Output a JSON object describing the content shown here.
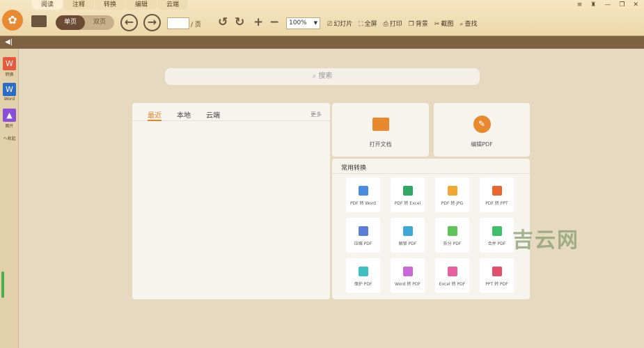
{
  "menu_tabs": [
    "阅读",
    "注释",
    "转换",
    "编辑",
    "云端"
  ],
  "toolbar": {
    "single_page": "单页",
    "double_page": "双页",
    "page_value": "",
    "page_suffix": "/ 页",
    "zoom": "100%",
    "tools": [
      {
        "icon": "slideshow-icon",
        "glyph": "⎚",
        "label": "幻灯片"
      },
      {
        "icon": "fullscreen-icon",
        "glyph": "⛶",
        "label": "全屏"
      },
      {
        "icon": "print-icon",
        "glyph": "⎙",
        "label": "打印"
      },
      {
        "icon": "background-icon",
        "glyph": "❐",
        "label": "背景"
      },
      {
        "icon": "screenshot-icon",
        "glyph": "✂",
        "label": "截图"
      },
      {
        "icon": "find-icon",
        "glyph": "⌕",
        "label": "查找"
      }
    ]
  },
  "sidebar": [
    {
      "label": "转换",
      "glyph": "W",
      "color": "#e8583e"
    },
    {
      "label": "Word",
      "glyph": "W",
      "color": "#2b6cc4"
    },
    {
      "label": "图片",
      "glyph": "▲",
      "color": "#8a4fd6"
    }
  ],
  "sidebar_collapse": "へ收起",
  "search": {
    "placeholder": "搜索"
  },
  "recent": {
    "tabs": [
      "最近",
      "本地",
      "云端"
    ],
    "more": "更多"
  },
  "actions": {
    "open": "打开文档",
    "edit": "编辑PDF"
  },
  "convert": {
    "title": "常用转换",
    "items": [
      {
        "label": "PDF 转 Word",
        "color": "#4a8de0"
      },
      {
        "label": "PDF 转 Excel",
        "color": "#2fa865"
      },
      {
        "label": "PDF 转 JPG",
        "color": "#f0a830"
      },
      {
        "label": "PDF 转 PPT",
        "color": "#e8672e"
      },
      {
        "label": "压缩 PDF",
        "color": "#5b7fd8"
      },
      {
        "label": "解锁 PDF",
        "color": "#3fa8d8"
      },
      {
        "label": "拆分 PDF",
        "color": "#5fc45a"
      },
      {
        "label": "合并 PDF",
        "color": "#3fbf6a"
      },
      {
        "label": "保护 PDF",
        "color": "#3fc0c0"
      },
      {
        "label": "Word 转 PDF",
        "color": "#c86ad8"
      },
      {
        "label": "Excel 转 PDF",
        "color": "#e860a0"
      },
      {
        "label": "PPT 转 PDF",
        "color": "#e0506a"
      }
    ]
  },
  "watermark": "吉云网",
  "colors": {
    "accent": "#e2842a",
    "toolbar_brown": "#7d6141"
  }
}
